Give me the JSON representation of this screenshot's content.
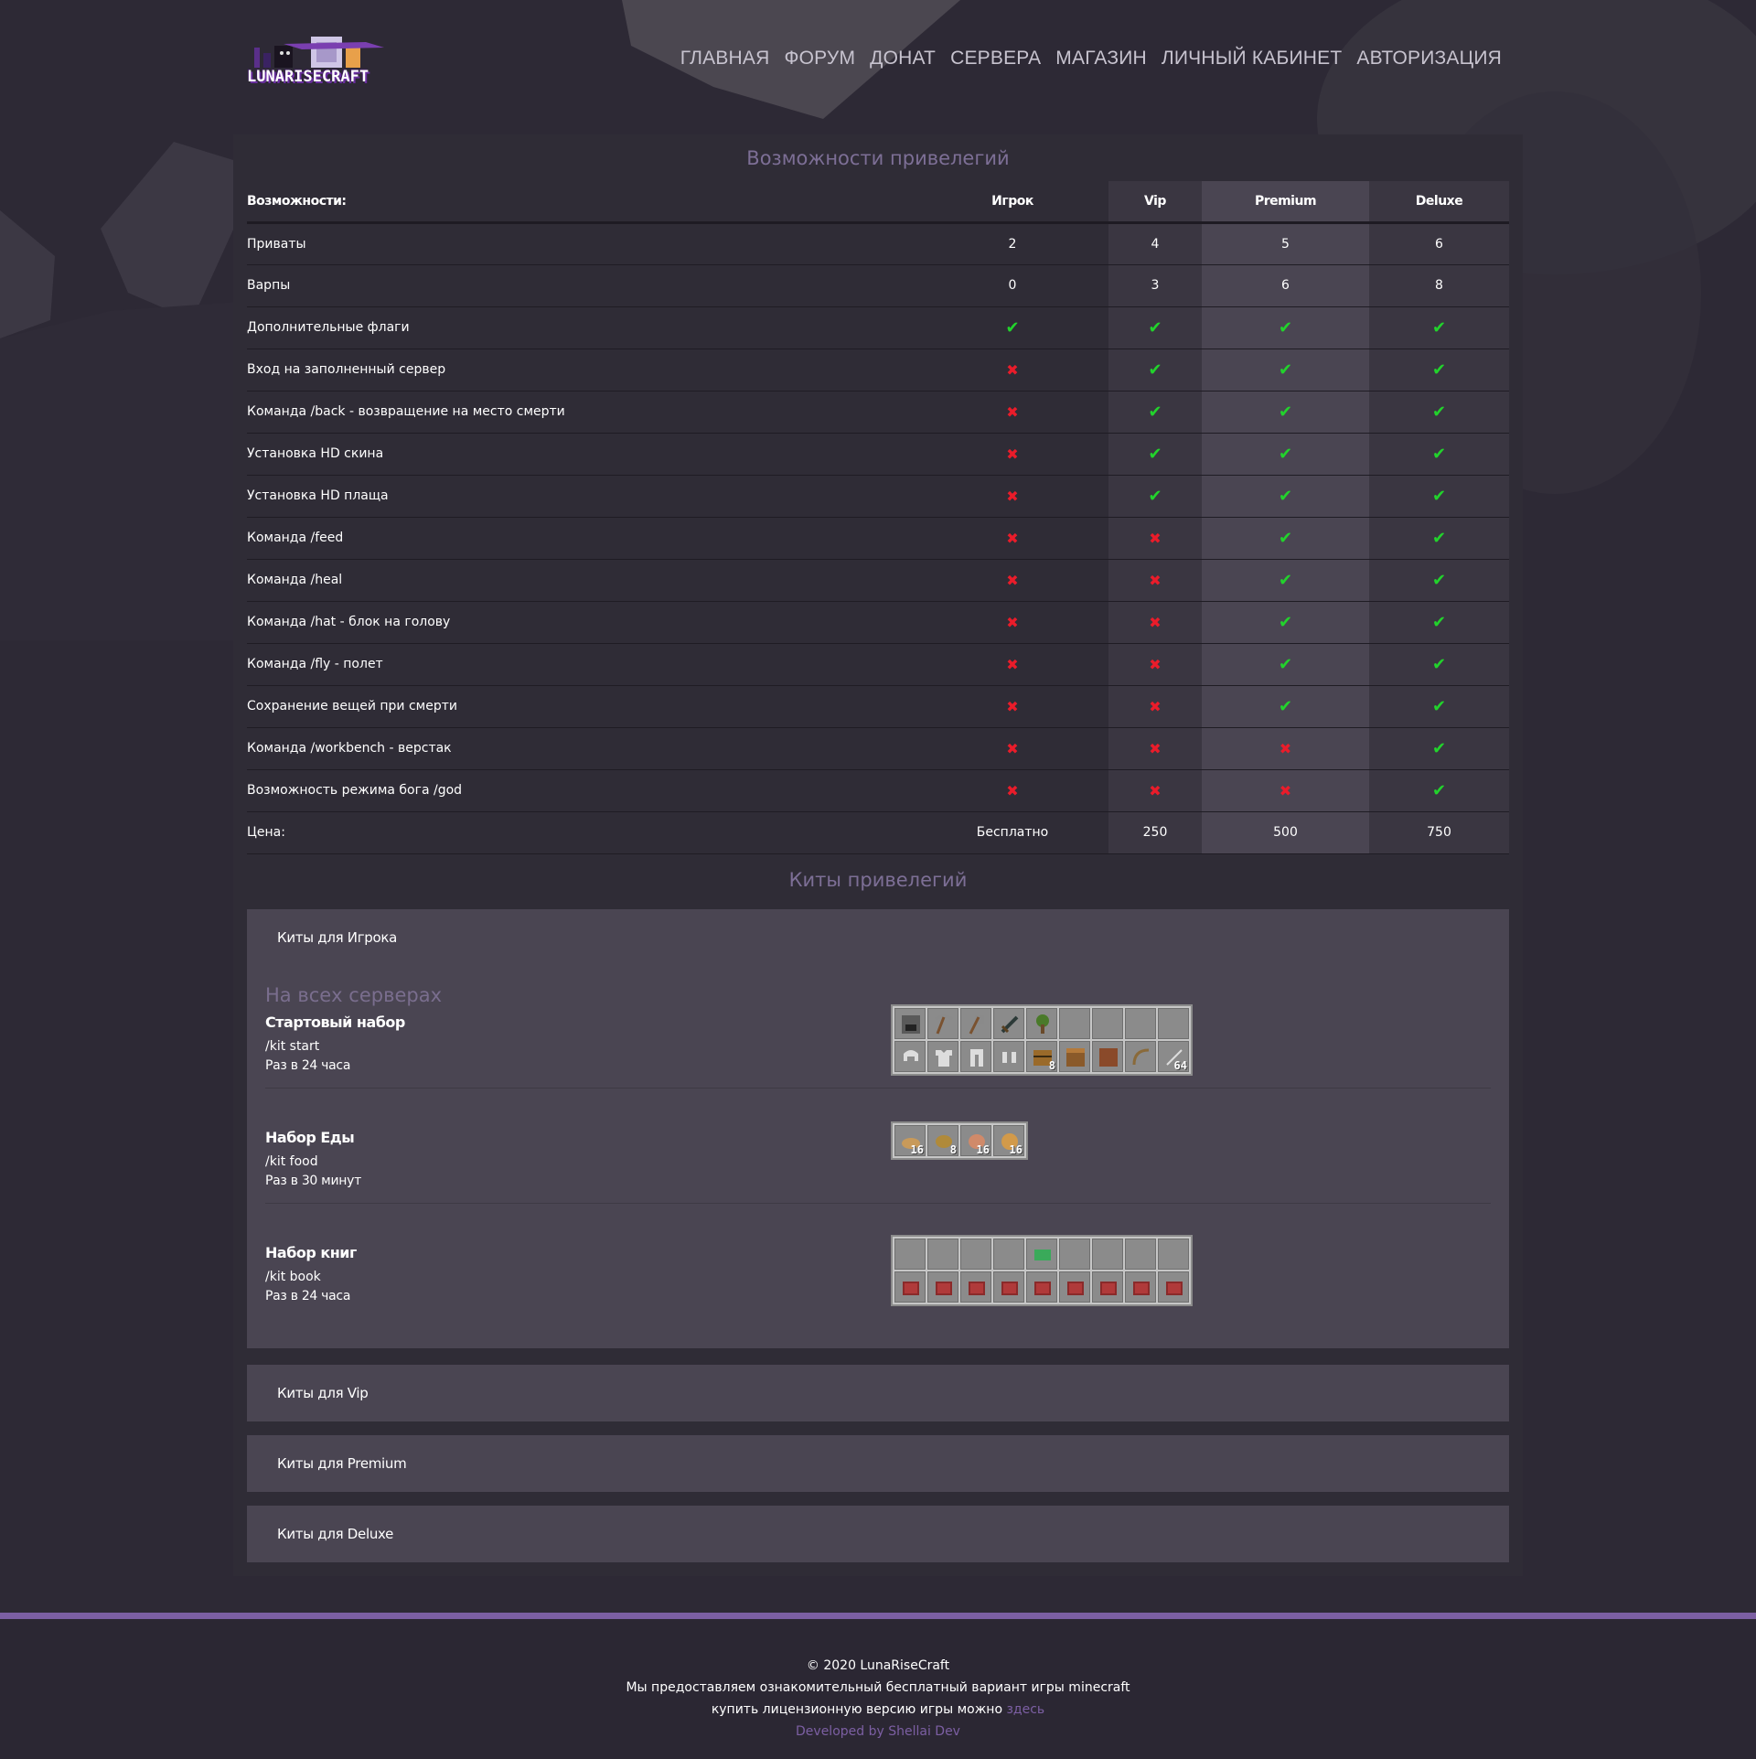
{
  "header": {
    "logo_text": "LUNARISECRAFT",
    "nav": [
      "ГЛАВНАЯ",
      "ФОРУМ",
      "ДОНАТ",
      "СЕРВЕРА",
      "МАГАЗИН",
      "ЛИЧНЫЙ КАБИНЕТ",
      "АВТОРИЗАЦИЯ"
    ]
  },
  "privileges": {
    "title": "Возможности привелегий",
    "columns": [
      "Возможности:",
      "Игрок",
      "Vip",
      "Premium",
      "Deluxe"
    ],
    "rows": [
      {
        "feature": "Приваты",
        "values": [
          "2",
          "4",
          "5",
          "6"
        ]
      },
      {
        "feature": "Варпы",
        "values": [
          "0",
          "3",
          "6",
          "8"
        ]
      },
      {
        "feature": "Дополнительные флаги",
        "values": [
          "yes",
          "yes",
          "yes",
          "yes"
        ]
      },
      {
        "feature": "Вход на заполненный сервер",
        "values": [
          "no",
          "yes",
          "yes",
          "yes"
        ]
      },
      {
        "feature": "Команда /back - возвращение на место смерти",
        "values": [
          "no",
          "yes",
          "yes",
          "yes"
        ]
      },
      {
        "feature": "Установка HD скина",
        "values": [
          "no",
          "yes",
          "yes",
          "yes"
        ]
      },
      {
        "feature": "Установка HD плаща",
        "values": [
          "no",
          "yes",
          "yes",
          "yes"
        ]
      },
      {
        "feature": "Команда /feed",
        "values": [
          "no",
          "no",
          "yes",
          "yes"
        ]
      },
      {
        "feature": "Команда /heal",
        "values": [
          "no",
          "no",
          "yes",
          "yes"
        ]
      },
      {
        "feature": "Команда /hat - блок на голову",
        "values": [
          "no",
          "no",
          "yes",
          "yes"
        ]
      },
      {
        "feature": "Команда /fly - полет",
        "values": [
          "no",
          "no",
          "yes",
          "yes"
        ]
      },
      {
        "feature": "Сохранение вещей при смерти",
        "values": [
          "no",
          "no",
          "yes",
          "yes"
        ]
      },
      {
        "feature": "Команда /workbench - верстак",
        "values": [
          "no",
          "no",
          "no",
          "yes"
        ]
      },
      {
        "feature": "Возможность режима бога /god",
        "values": [
          "no",
          "no",
          "no",
          "yes"
        ]
      }
    ],
    "price_label": "Цена:",
    "prices": [
      "Бесплатно",
      "250",
      "500",
      "750"
    ],
    "yes_color": "#22d32c",
    "no_color": "#ea1c2a"
  },
  "kits": {
    "title": "Киты привелегий",
    "panels": [
      "Киты для Игрока",
      "Киты для Vip",
      "Киты для Premium",
      "Киты для Deluxe"
    ],
    "subtitle": "На всех серверах",
    "items": [
      {
        "name": "Стартовый набор",
        "command": "/kit start",
        "cooldown": "Раз в 24 часа",
        "slots": [
          [
            "furnace-icon",
            ""
          ],
          [
            "pickaxe-icon",
            ""
          ],
          [
            "axe-icon",
            ""
          ],
          [
            "sword-icon",
            ""
          ],
          [
            "sapling-icon",
            ""
          ],
          [
            "",
            ""
          ],
          [
            "",
            ""
          ],
          [
            "",
            ""
          ],
          [
            "",
            ""
          ],
          [
            "helmet-icon",
            ""
          ],
          [
            "chestplate-icon",
            ""
          ],
          [
            "leggings-icon",
            ""
          ],
          [
            "boots-icon",
            ""
          ],
          [
            "chest-icon",
            "8"
          ],
          [
            "crafting-table-icon",
            ""
          ],
          [
            "block-icon",
            ""
          ],
          [
            "bow-icon",
            ""
          ],
          [
            "arrow-icon",
            "64"
          ]
        ]
      },
      {
        "name": "Набор Еды",
        "command": "/kit food",
        "cooldown": "Раз в 30 минут",
        "slots": [
          [
            "bread-icon",
            "16"
          ],
          [
            "potato-icon",
            "8"
          ],
          [
            "meat-icon",
            "16"
          ],
          [
            "cookie-icon",
            "16"
          ]
        ]
      },
      {
        "name": "Набор книг",
        "command": "/kit book",
        "cooldown": "Раз в 24 часа",
        "slots": [
          [
            "",
            ""
          ],
          [
            "",
            ""
          ],
          [
            "",
            ""
          ],
          [
            "",
            ""
          ],
          [
            "emerald-book-icon",
            ""
          ],
          [
            "",
            ""
          ],
          [
            "",
            ""
          ],
          [
            "",
            ""
          ],
          [
            "",
            ""
          ],
          [
            "book-icon",
            ""
          ],
          [
            "book-icon",
            ""
          ],
          [
            "book-icon",
            ""
          ],
          [
            "book-icon",
            ""
          ],
          [
            "book-icon",
            ""
          ],
          [
            "book-icon",
            ""
          ],
          [
            "book-icon",
            ""
          ],
          [
            "book-icon",
            ""
          ],
          [
            "book-icon",
            ""
          ]
        ]
      }
    ]
  },
  "footer": {
    "copyright": "© 2020 LunaRiseCraft",
    "line1": "Мы предоставляем ознакомительный бесплатный вариант игры minecraft",
    "line2": "купить лицензионную версию игры можно",
    "link": "здесь",
    "dev": "Developed by Shellai Dev",
    "accent": "#7c5fa3"
  }
}
